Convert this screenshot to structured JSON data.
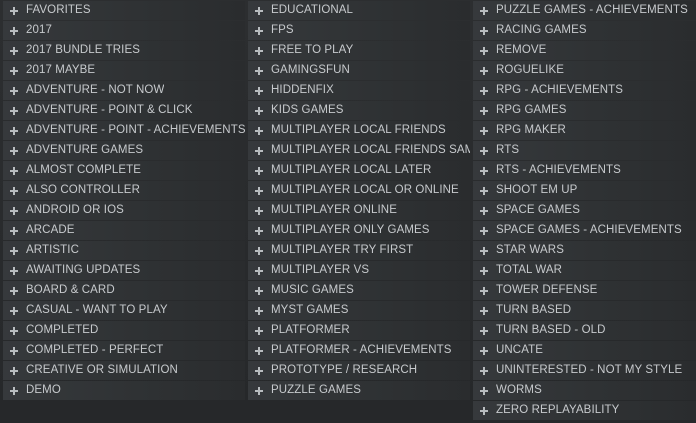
{
  "columns": [
    {
      "items": [
        "FAVORITES",
        "2017",
        "2017 BUNDLE TRIES",
        "2017 MAYBE",
        "ADVENTURE - NOT NOW",
        "ADVENTURE - POINT & CLICK",
        "ADVENTURE - POINT - ACHIEVEMENTS",
        "ADVENTURE GAMES",
        "ALMOST COMPLETE",
        "ALSO CONTROLLER",
        "ANDROID OR IOS",
        "ARCADE",
        "ARTISTIC",
        "AWAITING UPDATES",
        "BOARD & CARD",
        "CASUAL - WANT TO PLAY",
        "COMPLETED",
        "COMPLETED - PERFECT",
        "CREATIVE OR SIMULATION",
        "DEMO"
      ]
    },
    {
      "items": [
        "EDUCATIONAL",
        "FPS",
        "FREE TO PLAY",
        "GAMINGSFUN",
        "HIDDENFIX",
        "KIDS GAMES",
        "MULTIPLAYER LOCAL FRIENDS",
        "MULTIPLAYER LOCAL FRIENDS SAM",
        "MULTIPLAYER LOCAL LATER",
        "MULTIPLAYER LOCAL OR ONLINE",
        "MULTIPLAYER ONLINE",
        "MULTIPLAYER ONLY GAMES",
        "MULTIPLAYER TRY FIRST",
        "MULTIPLAYER VS",
        "MUSIC GAMES",
        "MYST GAMES",
        "PLATFORMER",
        "PLATFORMER - ACHIEVEMENTS",
        "PROTOTYPE / RESEARCH",
        "PUZZLE GAMES"
      ]
    },
    {
      "items": [
        "PUZZLE GAMES - ACHIEVEMENTS",
        "RACING GAMES",
        "REMOVE",
        "ROGUELIKE",
        "RPG - ACHIEVEMENTS",
        "RPG GAMES",
        "RPG MAKER",
        "RTS",
        "RTS - ACHIEVEMENTS",
        "SHOOT EM UP",
        "SPACE GAMES",
        "SPACE GAMES - ACHIEVEMENTS",
        "STAR WARS",
        "TOTAL WAR",
        "TOWER DEFENSE",
        "TURN BASED",
        "TURN BASED - OLD",
        "UNCATE",
        "UNINTERESTED - NOT MY STYLE",
        "WORMS",
        "ZERO REPLAYABILITY"
      ]
    }
  ],
  "icons": {
    "item_icon": "plus-icon"
  }
}
